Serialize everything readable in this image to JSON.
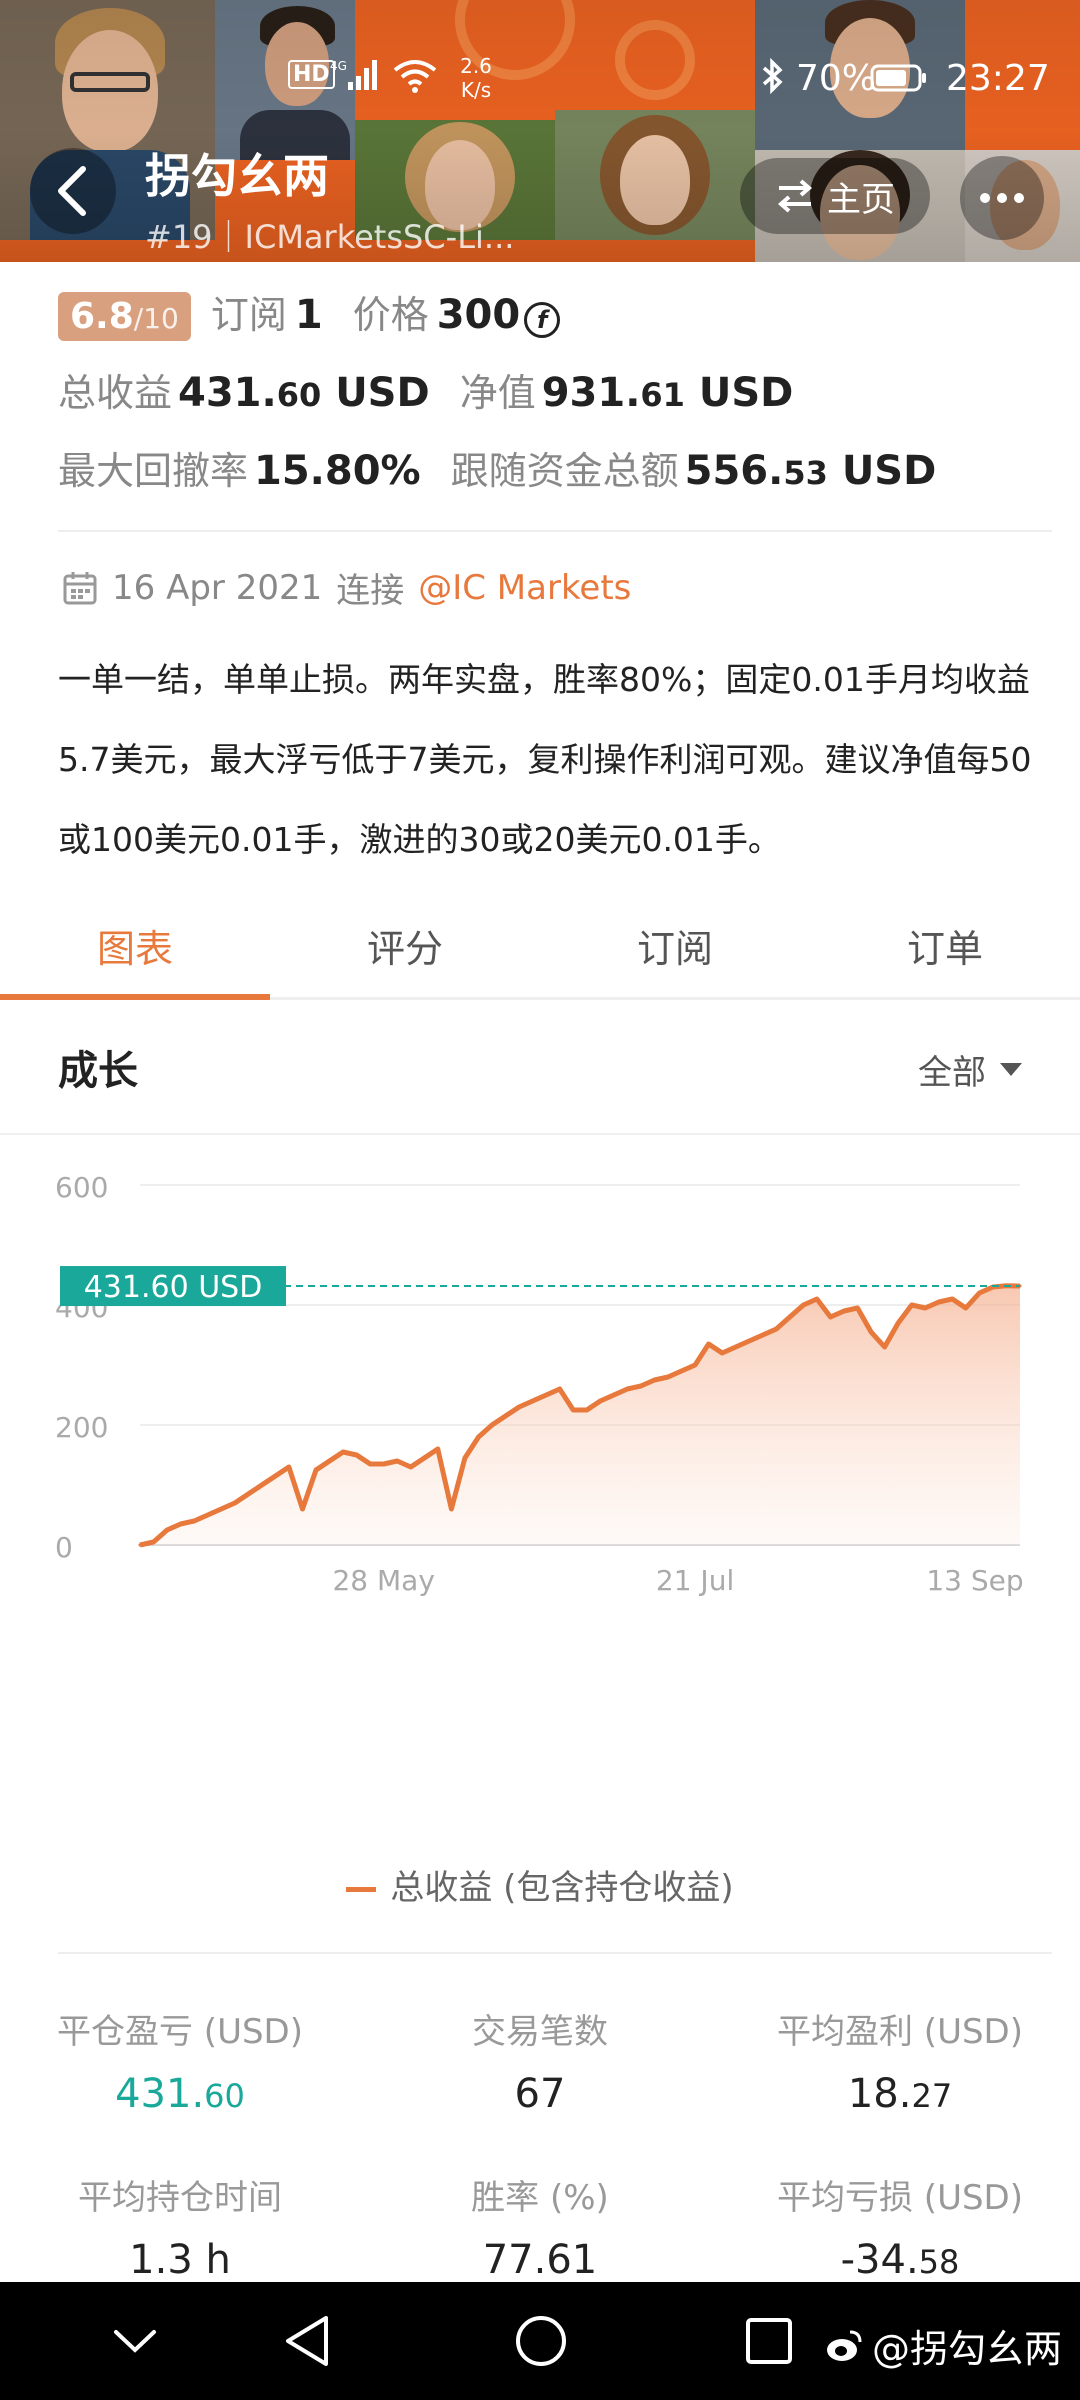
{
  "status_bar": {
    "network": "2.6 K/s",
    "battery": "70%",
    "time": "23:27"
  },
  "header": {
    "name": "拐勾幺两",
    "rank_account": "#19｜ICMarketsSC-Li...",
    "home_label": "主页"
  },
  "profile": {
    "score": "6.8",
    "score_max": "/10",
    "subscribe_label": "订阅",
    "subscribe_count": "1",
    "price_label": "价格",
    "price_value": "300",
    "price_coin_symbol": "f",
    "total_profit_label": "总收益",
    "total_profit_int": "431.",
    "total_profit_dec": "60",
    "total_profit_unit": "USD",
    "equity_label": "净值",
    "equity_int": "931.",
    "equity_dec": "61",
    "equity_unit": "USD",
    "max_drawdown_label": "最大回撤率",
    "max_drawdown_value": "15.80%",
    "follow_funds_label": "跟随资金总额",
    "follow_funds_int": "556.",
    "follow_funds_dec": "53",
    "follow_funds_unit": "USD"
  },
  "connection": {
    "date": "16 Apr 2021",
    "connect_label": "连接",
    "broker": "@IC Markets"
  },
  "description": "一单一结，单单止损。两年实盘，胜率80%；固定0.01手月均收益5.7美元，最大浮亏低于7美元，复利操作利润可观。建议净值每50或100美元0.01手，激进的30或20美元0.01手。",
  "tabs": [
    {
      "label": "图表",
      "active": true
    },
    {
      "label": "评分",
      "active": false
    },
    {
      "label": "订阅",
      "active": false
    },
    {
      "label": "订单",
      "active": false
    }
  ],
  "growth": {
    "title": "成长",
    "filter_label": "全部"
  },
  "chart_data": {
    "type": "area",
    "title": "",
    "xlabel": "",
    "ylabel": "",
    "ylim": [
      0,
      600
    ],
    "y_ticks": [
      "600",
      "400",
      "200",
      "0"
    ],
    "x_tick_labels": [
      "28 May",
      "21 Jul",
      "13 Sep"
    ],
    "current_value_label": "431.60 USD",
    "current_value": 431.6,
    "color": "#e8793d",
    "grid": true,
    "legend": "bottom",
    "series": [
      {
        "name": "总收益 (包含持仓收益)",
        "x": [
          "16 Apr",
          "19 Apr",
          "21 Apr",
          "23 Apr",
          "26 Apr",
          "28 Apr",
          "30 Apr",
          "3 May",
          "5 May",
          "7 May",
          "10 May",
          "12 May",
          "14 May",
          "17 May",
          "19 May",
          "21 May",
          "24 May",
          "26 May",
          "28 May",
          "31 May",
          "2 Jun",
          "4 Jun",
          "7 Jun",
          "9 Jun",
          "11 Jun",
          "14 Jun",
          "16 Jun",
          "18 Jun",
          "21 Jun",
          "23 Jun",
          "25 Jun",
          "28 Jun",
          "30 Jun",
          "2 Jul",
          "5 Jul",
          "7 Jul",
          "9 Jul",
          "12 Jul",
          "14 Jul",
          "16 Jul",
          "19 Jul",
          "21 Jul",
          "23 Jul",
          "26 Jul",
          "28 Jul",
          "30 Jul",
          "2 Aug",
          "4 Aug",
          "6 Aug",
          "9 Aug",
          "11 Aug",
          "13 Aug",
          "16 Aug",
          "18 Aug",
          "20 Aug",
          "23 Aug",
          "25 Aug",
          "27 Aug",
          "30 Aug",
          "1 Sep",
          "3 Sep",
          "6 Sep",
          "8 Sep",
          "10 Sep",
          "13 Sep",
          "15 Sep"
        ],
        "values": [
          0,
          5,
          25,
          35,
          40,
          50,
          60,
          70,
          85,
          100,
          115,
          130,
          60,
          125,
          140,
          155,
          150,
          135,
          135,
          140,
          130,
          145,
          160,
          60,
          145,
          180,
          200,
          215,
          230,
          240,
          250,
          260,
          225,
          225,
          240,
          250,
          260,
          265,
          275,
          280,
          290,
          300,
          335,
          320,
          330,
          340,
          350,
          360,
          380,
          400,
          410,
          380,
          390,
          395,
          355,
          330,
          370,
          400,
          395,
          405,
          410,
          395,
          420,
          430,
          432,
          431.6
        ]
      }
    ]
  },
  "stats": {
    "closed_pnl_label": "平仓盈亏 (USD)",
    "closed_pnl_int": "431.",
    "closed_pnl_dec": "60",
    "trades_label": "交易笔数",
    "trades_value": "67",
    "avg_profit_label": "平均盈利 (USD)",
    "avg_profit_int": "18.",
    "avg_profit_dec": "27",
    "avg_hold_label": "平均持仓时间",
    "avg_hold_value": "1.3 h",
    "win_rate_label": "胜率 (%)",
    "win_rate_value": "77.61",
    "avg_loss_label": "平均亏损 (USD)",
    "avg_loss_int": "-34.",
    "avg_loss_dec": "58"
  },
  "watermark": "@拐勾幺两",
  "colors": {
    "accent": "#e8793d",
    "green": "#1aa89a",
    "banner": "#f26522",
    "score_badge": "#d9a080"
  }
}
